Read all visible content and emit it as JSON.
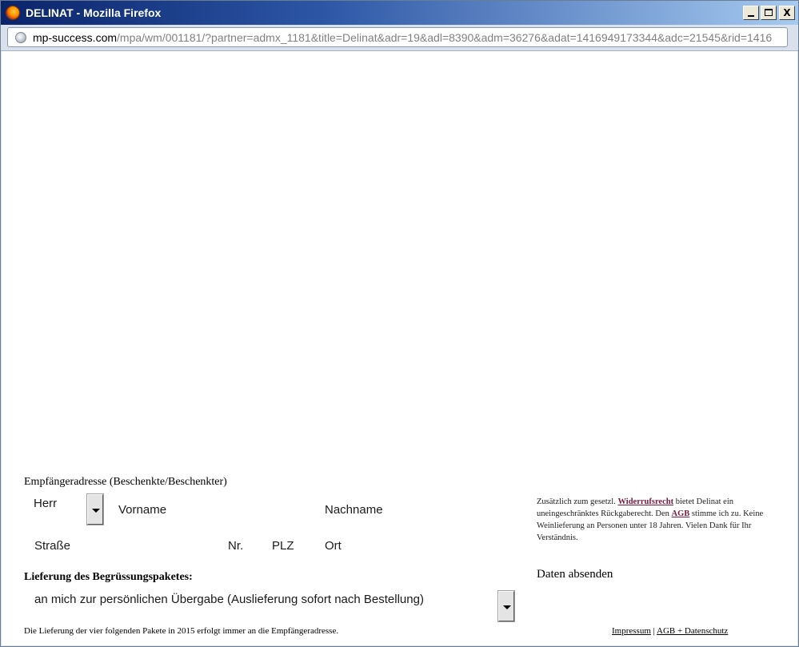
{
  "window": {
    "title": "DELINAT - Mozilla Firefox",
    "controls": {
      "minimize": "",
      "maximize": "",
      "close": "X"
    }
  },
  "urlbar": {
    "host": "mp-success.com",
    "path": "/mpa/wm/001181/?partner=admx_1181&title=Delinat&adr=19&adl=8390&adm=36276&adat=1416949173344&adc=21545&rid=1416"
  },
  "form": {
    "section_title": "Empfängeradresse (Beschenkte/Beschenkter)",
    "salutation_value": "Herr",
    "fields": {
      "firstname": "Vorname",
      "lastname": "Nachname",
      "street": "Straße",
      "number": "Nr.",
      "zip": "PLZ",
      "city": "Ort"
    },
    "delivery_title": "Lieferung des Begrüssungspaketes:",
    "delivery_value": "an mich zur persönlichen Übergabe (Auslieferung sofort nach Bestellung)",
    "footnote": "Die Lieferung der vier folgenden Pakete in 2015 erfolgt immer an die Empfängeradresse."
  },
  "legal": {
    "part1": "Zusätzlich zum gesetzl. ",
    "link_widerruf": "Widerrufsrecht",
    "part2": " bietet Delinat ein uneingeschränktes Rückgaberecht. Den ",
    "link_agb": "AGB",
    "part3": " stimme ich zu. Keine Weinlieferung an Personen unter 18 Jahren. Vielen Dank für Ihr Verständnis."
  },
  "submit_label": "Daten absenden",
  "footer": {
    "impressum": "Impressum",
    "separator": " | ",
    "agb_datenschutz": "AGB + Datenschutz"
  }
}
